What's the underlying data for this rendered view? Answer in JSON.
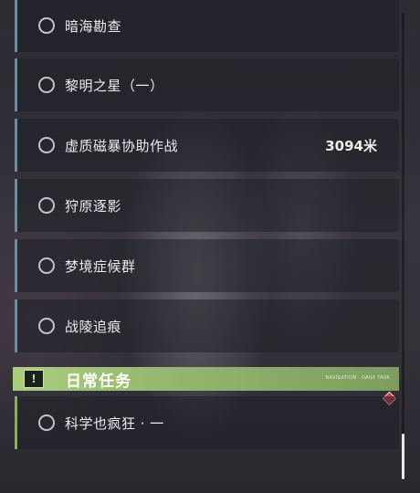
{
  "quests": [
    {
      "label": "暗海勘查",
      "distance": ""
    },
    {
      "label": "黎明之星（一）",
      "distance": ""
    },
    {
      "label": "虚质磁暴协助作战",
      "distance": "3094米"
    },
    {
      "label": "狩原逐影",
      "distance": ""
    },
    {
      "label": "梦境症候群",
      "distance": ""
    },
    {
      "label": "战陵追痕",
      "distance": ""
    }
  ],
  "daily_section": {
    "title": "日常任务",
    "icon": "exclamation-icon",
    "icon_glyph": "!",
    "tag": "NAVIGATION · DAILY TASK",
    "items": [
      {
        "label": "科学也疯狂 · 一"
      }
    ]
  },
  "colors": {
    "main_quest_accent": "#6f8a9b",
    "daily_accent": "#8daa62",
    "alert": "#d73a52"
  }
}
